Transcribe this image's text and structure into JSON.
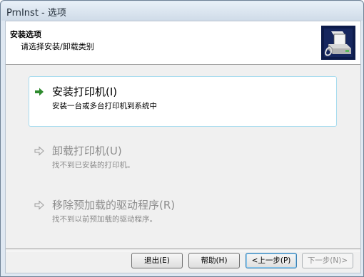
{
  "window": {
    "title": "PrnInst - 选项"
  },
  "header": {
    "title": "安装选项",
    "subtitle": "请选择安装/卸载类别",
    "icon": "printer-icon"
  },
  "options": [
    {
      "title": "安装打印机(I)",
      "description": "安装一台或多台打印机到系统中",
      "state": "enabled"
    },
    {
      "title": "卸载打印机(U)",
      "description": "找不到已安装的打印机。",
      "state": "disabled"
    },
    {
      "title": "移除预加载的驱动程序(R)",
      "description": "找不到以前预加载的驱动程序。",
      "state": "disabled"
    }
  ],
  "buttons": {
    "exit": "退出(E)",
    "help": "帮助(H)",
    "back": "<上一步(P)",
    "next": "下一步(N)>"
  },
  "colors": {
    "accent_arrow": "#2e8b2e",
    "selected_border": "#a7dcef"
  }
}
